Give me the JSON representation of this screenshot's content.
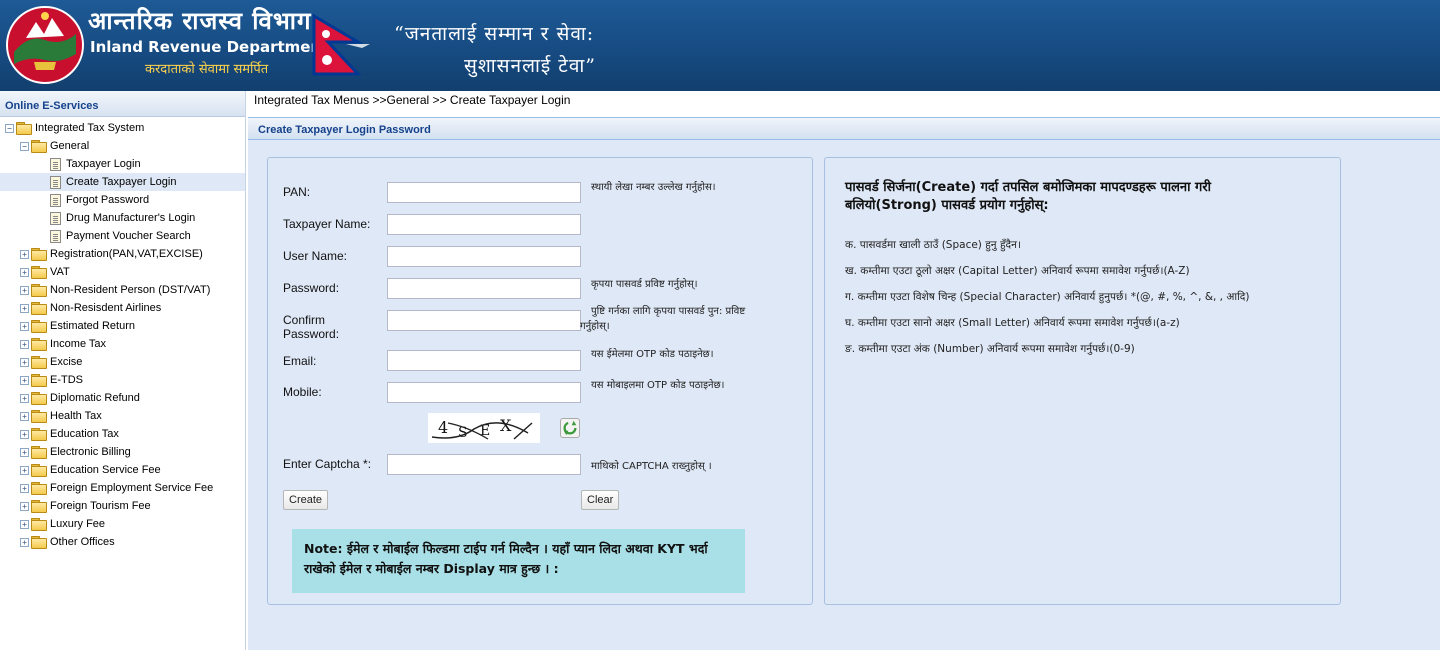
{
  "header": {
    "title_np": "आन्तरिक राजस्व विभाग",
    "title_en": "Inland Revenue Department",
    "subtitle": "करदाताको सेवामा समर्पित",
    "motto_line1": "“जनतालाई सम्मान र सेवा:",
    "motto_line2": "सुशासनलाई टेवा”",
    "brand_color": "#1b5390"
  },
  "sidebar": {
    "title": "Online E-Services",
    "root": "Integrated Tax System",
    "general": "General",
    "general_items": [
      "Taxpayer Login",
      "Create Taxpayer Login",
      "Forgot Password",
      "Drug Manufacturer's Login",
      "Payment Voucher Search"
    ],
    "selected_item": "Create Taxpayer Login",
    "folders": [
      "Registration(PAN,VAT,EXCISE)",
      "VAT",
      "Non-Resident Person (DST/VAT)",
      "Non-Resisdent Airlines",
      "Estimated Return",
      "Income Tax",
      "Excise",
      "E-TDS",
      "Diplomatic Refund",
      "Health Tax",
      "Education Tax",
      "Electronic Billing",
      "Education Service Fee",
      "Foreign Employment Service Fee",
      "Foreign Tourism Fee",
      "Luxury Fee",
      "Other Offices"
    ]
  },
  "breadcrumb": "Integrated Tax Menus >>General >> Create Taxpayer Login",
  "panel": {
    "title": "Create Taxpayer Login Password"
  },
  "form": {
    "pan": {
      "label": "PAN:",
      "value": "",
      "hint": "स्थायी लेखा नम्बर उल्लेख गर्नुहोस।"
    },
    "taxpayer_name": {
      "label": "Taxpayer Name:",
      "value": ""
    },
    "user_name": {
      "label": "User Name:",
      "value": ""
    },
    "password": {
      "label": "Password:",
      "value": "",
      "hint": "कृपया पासवर्ड प्रविष्ट गर्नुहोस्।"
    },
    "confirm_password": {
      "label_line1": "Confirm",
      "label_line2": "Password:",
      "value": "",
      "hint_line1": "पुष्टि गर्नका लागि कृपया पासवर्ड पुन: प्रविष्ट",
      "hint_line2": "गर्नुहोस्।"
    },
    "email": {
      "label": "Email:",
      "value": "",
      "hint": "यस ईमेलमा OTP कोड पठाइनेछ।"
    },
    "mobile": {
      "label": "Mobile:",
      "value": "",
      "hint": "यस मोबाइलमा OTP कोड पठाइनेछ।"
    },
    "captcha": {
      "label": "Enter Captcha *:",
      "value": "",
      "hint": "माथिको CAPTCHA राख्नुहोस् ।",
      "chars": [
        "4",
        "S",
        "E",
        "X"
      ]
    },
    "create_label": "Create",
    "clear_label": "Clear",
    "note": "Note: ईमेल र मोबाईल फिल्डमा टाईप गर्न मिल्दैन । यहाँ प्यान लिदा अथवा KYT भर्दा राखेको ईमेल र मोबाईल नम्बर Display मात्र हुन्छ । :"
  },
  "rules": {
    "title": "पासवर्ड सिर्जना(Create) गर्दा तपसिल बमोजिमका मापदण्डहरू पालना गरी बलियो(Strong) पासवर्ड प्रयोग गर्नुहोस्:",
    "items": [
      "क. पासवर्डमा खाली ठाउँ (Space) हुनु हुँदैन।",
      "ख. कम्तीमा एउटा ठूलो अक्षर (Capital Letter) अनिवार्य रूपमा समावेश गर्नुपर्छ।(A-Z)",
      "ग. कम्तीमा एउटा विशेष चिन्ह (Special Character) अनिवार्य हुनुपर्छ। *(@, #, %, ^, &, , आदि)",
      "घ. कम्तीमा एउटा सानो अक्षर (Small Letter) अनिवार्य रूपमा समावेश गर्नुपर्छ।(a-z)",
      "ङ. कम्तीमा एउटा अंक (Number) अनिवार्य रूपमा समावेश गर्नुपर्छ।(0-9)"
    ]
  }
}
